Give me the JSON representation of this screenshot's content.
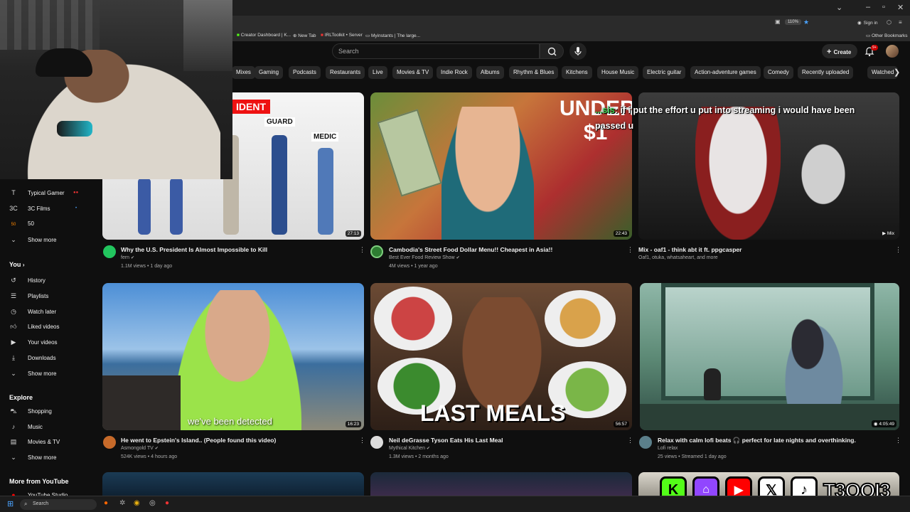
{
  "browser": {
    "zoom": "110%",
    "signin": "Sign in",
    "other_bookmarks": "Other Bookmarks",
    "bookmarks": [
      "Creator Dashboard | K...",
      "New Tab",
      "IRLToolkit • Server",
      "Myinstants | The large..."
    ]
  },
  "header": {
    "search_placeholder": "Search",
    "create_label": "Create",
    "notif_count": "9+"
  },
  "chips": [
    "Mixes",
    "Gaming",
    "Podcasts",
    "Restaurants",
    "Live",
    "Movies & TV",
    "Indie Rock",
    "Albums",
    "Rhythm & Blues",
    "Kitchens",
    "House Music",
    "Electric guitar",
    "Action-adventure games",
    "Comedy",
    "Recently uploaded",
    "Watched"
  ],
  "sidebar": {
    "subs": [
      {
        "label": "Typical Gamer",
        "icon": "T"
      },
      {
        "label": "3C Films",
        "icon": "3C"
      },
      {
        "label": "50",
        "icon": "50"
      }
    ],
    "show_more_1": "Show more",
    "you_header": "You",
    "you_items": [
      "History",
      "Playlists",
      "Watch later",
      "Liked videos",
      "Your videos",
      "Downloads"
    ],
    "show_more_2": "Show more",
    "explore_header": "Explore",
    "explore_items": [
      "Shopping",
      "Music",
      "Movies & TV"
    ],
    "show_more_3": "Show more",
    "more_header": "More from YouTube",
    "more_item": "YouTube Studio"
  },
  "videos": [
    {
      "title": "Why the U.S. President Is Almost Impossible to Kill",
      "channel": "fern",
      "meta": "1.1M views • 1 day ago",
      "duration": "27:13",
      "thumb_labels": [
        "IDENT",
        "GUARD",
        "MEDIC"
      ]
    },
    {
      "title": "Cambodia's Street Food Dollar Menu!! Cheapest in Asia!!",
      "channel": "Best Ever Food Review Show",
      "meta": "4M views • 1 year ago",
      "duration": "22:43",
      "thumb_labels": [
        "UNDER",
        "$1"
      ]
    },
    {
      "title": "Mix - oaf1 - think abt it ft. ppgcasper",
      "channel": "Oaf1, otuka, whatsaheart, and more",
      "meta": "",
      "duration": "Mix"
    },
    {
      "title": "He went to Epstein's Island.. (People found this video)",
      "channel": "Asmongold TV",
      "meta": "524K views • 4 hours ago",
      "duration": "16:23",
      "thumb_labels": [
        "we've been detected"
      ]
    },
    {
      "title": "Neil deGrasse Tyson Eats His Last Meal",
      "channel": "Mythical Kitchen",
      "meta": "1.3M views • 2 months ago",
      "duration": "56:57",
      "thumb_labels": [
        "LAST MEALS"
      ]
    },
    {
      "title": "Relax with calm lofi beats 🎧 perfect for late nights and overthinking.",
      "channel": "Lofi relax",
      "meta": "25 views • Streamed 1 day ago",
      "duration": "4:05:49"
    }
  ],
  "chat": {
    "user": "...sis",
    "message": ": if i put the effort u put into streaming i would have been",
    "message2": "passed u"
  },
  "social": {
    "handle": "T3QQI3"
  },
  "taskbar": {
    "search": "Search"
  },
  "colors": {
    "bg": "#0f0f0f",
    "chip": "#272727",
    "accent_red": "#ff0000",
    "kick_green": "#53fc18",
    "twitch_purple": "#9146ff"
  }
}
